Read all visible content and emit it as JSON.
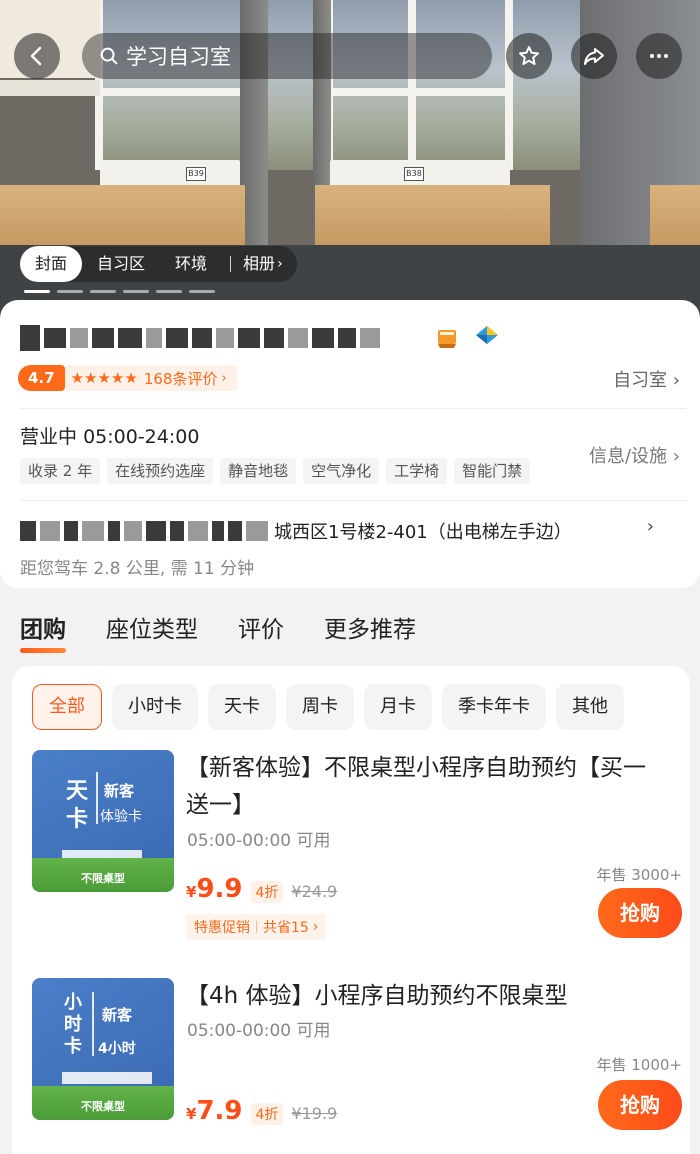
{
  "header": {
    "search_text": "学习自习室",
    "icons": [
      "back-arrow",
      "search",
      "star",
      "share",
      "more"
    ]
  },
  "hero": {
    "tabs": [
      "封面",
      "自习区",
      "环境"
    ],
    "album_label": "相册",
    "seat_labels": [
      "B39",
      "B38"
    ]
  },
  "shop": {
    "rating_score": "4.7",
    "stars": "★★★★★",
    "review_count": "168条评价",
    "category": "自习室",
    "status": "营业中",
    "hours": "05:00-24:00",
    "tags": [
      "收录 2 年",
      "在线预约选座",
      "静音地毯",
      "空气净化",
      "工学椅",
      "智能门禁"
    ],
    "facilities_label": "信息/设施",
    "address_visible": "城西区1号楼2-401（出电梯左手边）",
    "distance": "距您驾车 2.8 公里, 需 11 分钟"
  },
  "section_tabs": [
    "团购",
    "座位类型",
    "评价",
    "更多推荐"
  ],
  "filters": [
    "全部",
    "小时卡",
    "天卡",
    "周卡",
    "月卡",
    "季卡年卡",
    "其他"
  ],
  "deals": [
    {
      "title": "【新客体验】不限桌型小程序自助预约【买一送一】",
      "time": "05:00-00:00 可用",
      "price_symbol": "¥",
      "price": "9.9",
      "discount": "4折",
      "original_price": "¥24.9",
      "promo_label": "特惠促销",
      "promo_saving": "共省15",
      "sales": "年售 3000+",
      "buy_label": "抢购",
      "thumb": {
        "big": "天卡",
        "tag": "新客",
        "sub": "体验卡",
        "foot": "不限桌型"
      }
    },
    {
      "title": "【4h 体验】小程序自助预约不限桌型",
      "time": "05:00-00:00 可用",
      "price_symbol": "¥",
      "price": "7.9",
      "discount": "4折",
      "original_price": "¥19.9",
      "sales": "年售 1000+",
      "buy_label": "抢购",
      "thumb": {
        "big": "小时卡",
        "tag": "新客",
        "sub": "4小时",
        "foot": "不限桌型"
      }
    }
  ],
  "colors": {
    "accent": "#ff5a1a",
    "price": "#ff4d1a"
  }
}
